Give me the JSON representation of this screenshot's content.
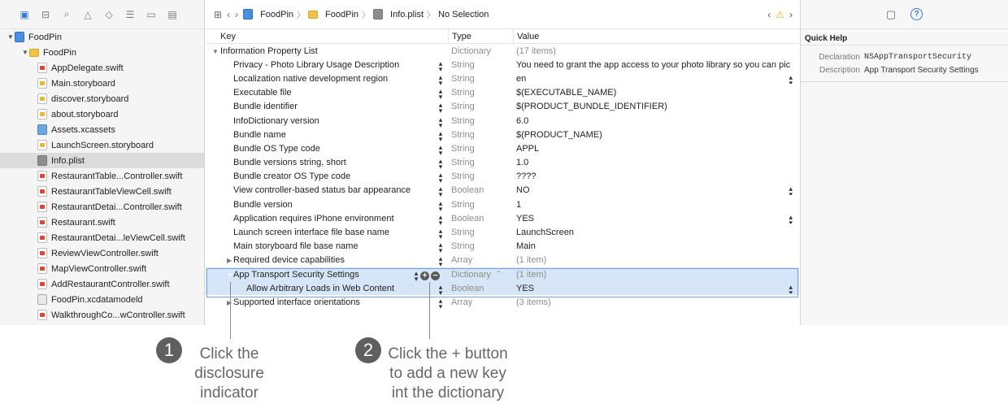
{
  "navigator": {
    "tree": [
      {
        "label": "FoodPin",
        "icon": "project-icon",
        "level": 0,
        "expanded": true,
        "kind": "proj"
      },
      {
        "label": "FoodPin",
        "icon": "folder-icon",
        "level": 1,
        "expanded": true,
        "kind": "folder"
      },
      {
        "label": "AppDelegate.swift",
        "icon": "swift-file-icon",
        "level": 2,
        "kind": "swift"
      },
      {
        "label": "Main.storyboard",
        "icon": "storyboard-file-icon",
        "level": 2,
        "kind": "sb"
      },
      {
        "label": "discover.storyboard",
        "icon": "storyboard-file-icon",
        "level": 2,
        "kind": "sb"
      },
      {
        "label": "about.storyboard",
        "icon": "storyboard-file-icon",
        "level": 2,
        "kind": "sb"
      },
      {
        "label": "Assets.xcassets",
        "icon": "assets-icon",
        "level": 2,
        "kind": "assets"
      },
      {
        "label": "LaunchScreen.storyboard",
        "icon": "storyboard-file-icon",
        "level": 2,
        "kind": "sb"
      },
      {
        "label": "Info.plist",
        "icon": "plist-file-icon",
        "level": 2,
        "kind": "plist",
        "selected": true
      },
      {
        "label": "RestaurantTable...Controller.swift",
        "icon": "swift-file-icon",
        "level": 2,
        "kind": "swift"
      },
      {
        "label": "RestaurantTableViewCell.swift",
        "icon": "swift-file-icon",
        "level": 2,
        "kind": "swift"
      },
      {
        "label": "RestaurantDetai...Controller.swift",
        "icon": "swift-file-icon",
        "level": 2,
        "kind": "swift"
      },
      {
        "label": "Restaurant.swift",
        "icon": "swift-file-icon",
        "level": 2,
        "kind": "swift"
      },
      {
        "label": "RestaurantDetai...leViewCell.swift",
        "icon": "swift-file-icon",
        "level": 2,
        "kind": "swift"
      },
      {
        "label": "ReviewViewController.swift",
        "icon": "swift-file-icon",
        "level": 2,
        "kind": "swift"
      },
      {
        "label": "MapViewController.swift",
        "icon": "swift-file-icon",
        "level": 2,
        "kind": "swift"
      },
      {
        "label": "AddRestaurantController.swift",
        "icon": "swift-file-icon",
        "level": 2,
        "kind": "swift"
      },
      {
        "label": "FoodPin.xcdatamodeld",
        "icon": "datamodel-icon",
        "level": 2,
        "kind": "model"
      },
      {
        "label": "WalkthroughCo...wController.swift",
        "icon": "swift-file-icon",
        "level": 2,
        "kind": "swift"
      }
    ]
  },
  "jumpbar": {
    "crumbs": [
      "FoodPin",
      "FoodPin",
      "Info.plist",
      "No Selection"
    ]
  },
  "plist": {
    "headers": {
      "key": "Key",
      "type": "Type",
      "value": "Value"
    },
    "root": {
      "key": "Information Property List",
      "type": "Dictionary",
      "value": "(17 items)"
    },
    "rows": [
      {
        "key": "Privacy - Photo Library Usage Description",
        "type": "String",
        "value": "You need to grant the app access to your photo library so you can pic",
        "vstep": false
      },
      {
        "key": "Localization native development region",
        "type": "String",
        "value": "en",
        "vstep": true
      },
      {
        "key": "Executable file",
        "type": "String",
        "value": "$(EXECUTABLE_NAME)",
        "vstep": false
      },
      {
        "key": "Bundle identifier",
        "type": "String",
        "value": "$(PRODUCT_BUNDLE_IDENTIFIER)",
        "vstep": false
      },
      {
        "key": "InfoDictionary version",
        "type": "String",
        "value": "6.0",
        "vstep": false
      },
      {
        "key": "Bundle name",
        "type": "String",
        "value": "$(PRODUCT_NAME)",
        "vstep": false
      },
      {
        "key": "Bundle OS Type code",
        "type": "String",
        "value": "APPL",
        "vstep": false
      },
      {
        "key": "Bundle versions string, short",
        "type": "String",
        "value": "1.0",
        "vstep": false
      },
      {
        "key": "Bundle creator OS Type code",
        "type": "String",
        "value": "????",
        "vstep": false
      },
      {
        "key": "View controller-based status bar appearance",
        "type": "Boolean",
        "value": "NO",
        "vstep": true
      },
      {
        "key": "Bundle version",
        "type": "String",
        "value": "1",
        "vstep": false
      },
      {
        "key": "Application requires iPhone environment",
        "type": "Boolean",
        "value": "YES",
        "vstep": true
      },
      {
        "key": "Launch screen interface file base name",
        "type": "String",
        "value": "LaunchScreen",
        "vstep": false
      },
      {
        "key": "Main storyboard file base name",
        "type": "String",
        "value": "Main",
        "vstep": false
      },
      {
        "key": "Required device capabilities",
        "type": "Array",
        "value": "(1 item)",
        "disclosure": "collapsed",
        "dim": true
      },
      {
        "key": "App Transport Security Settings",
        "type": "Dictionary",
        "value": "(1 item)",
        "disclosure": "expanded",
        "dim": true,
        "selected": true
      },
      {
        "key": "Allow Arbitrary Loads in Web Content",
        "type": "Boolean",
        "value": "YES",
        "vstep": true,
        "child": true,
        "selected": true
      },
      {
        "key": "Supported interface orientations",
        "type": "Array",
        "value": "(3 items)",
        "disclosure": "collapsed",
        "dim": true
      }
    ]
  },
  "inspector": {
    "title": "Quick Help",
    "declaration_label": "Declaration",
    "declaration": "NSAppTransportSecurity",
    "description_label": "Description",
    "description": "App Transport Security Settings"
  },
  "annotations": [
    {
      "number": "1",
      "text": "Click the\ndisclosure\nindicator"
    },
    {
      "number": "2",
      "text": "Click the + button\nto add a new key\nint the dictionary"
    }
  ]
}
